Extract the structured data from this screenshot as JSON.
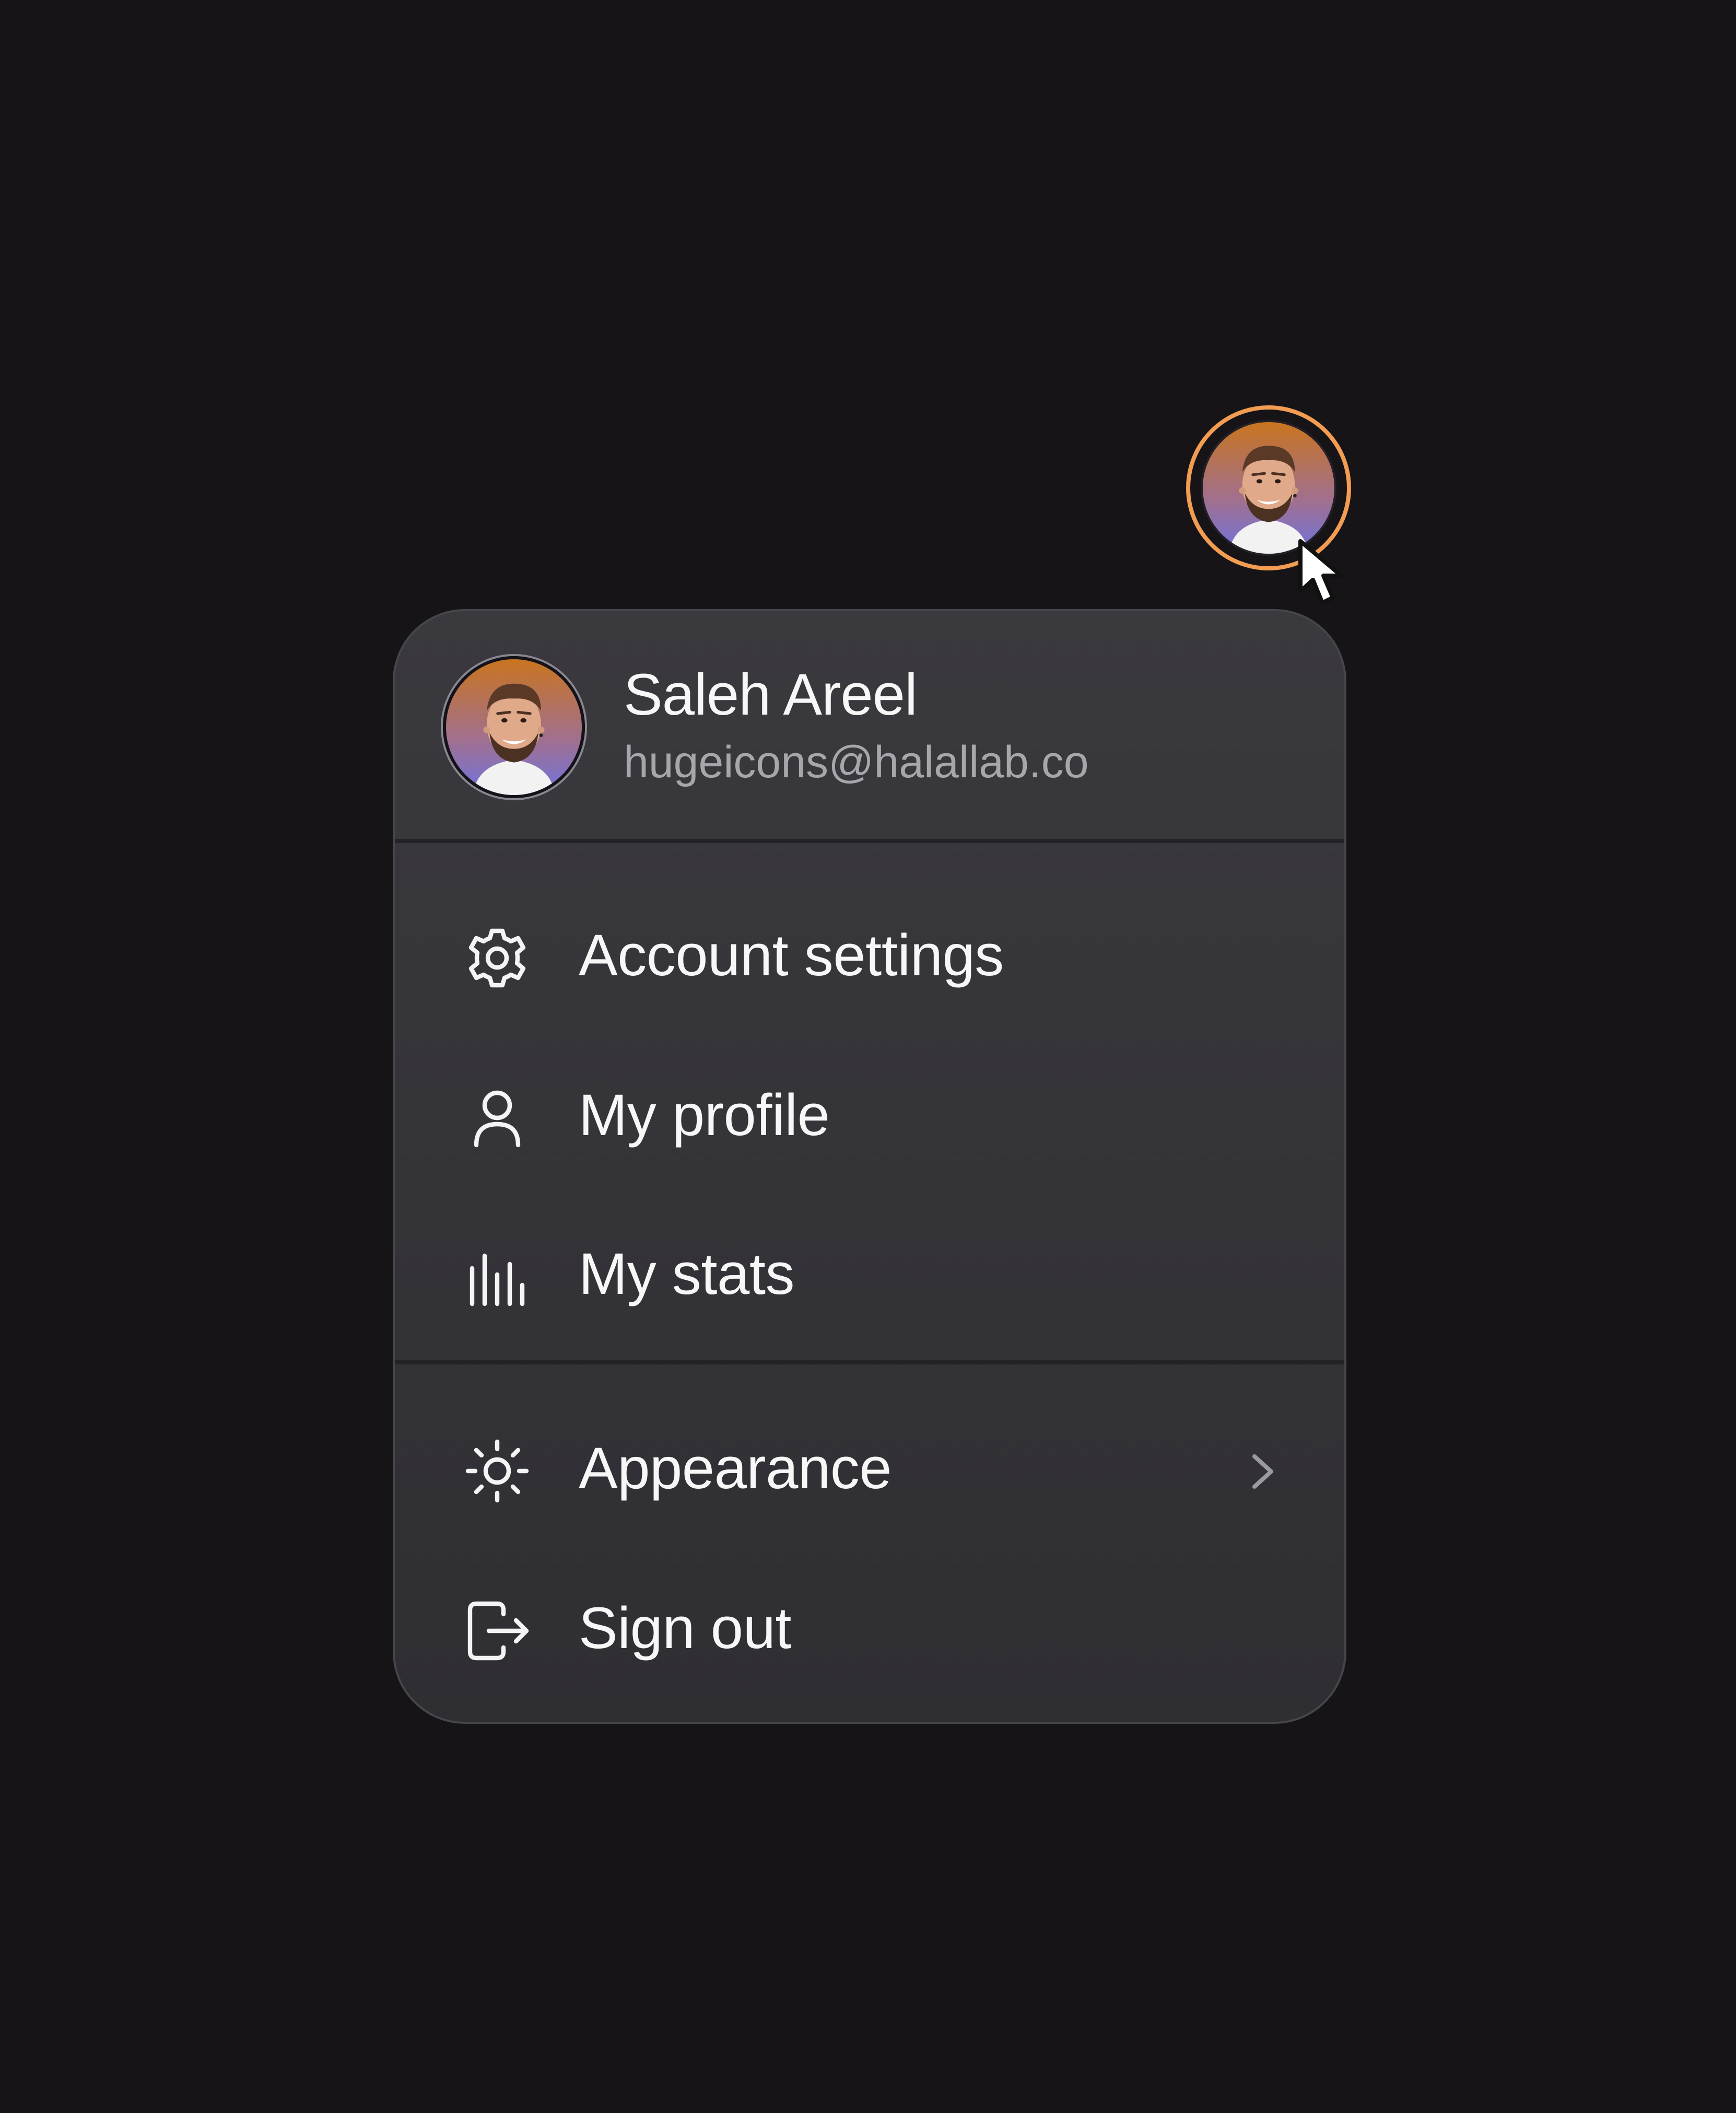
{
  "user": {
    "name": "Saleh Areel",
    "email": "hugeicons@halallab.co"
  },
  "menu": {
    "items": [
      {
        "label": "Account settings",
        "icon": "gear-icon"
      },
      {
        "label": "My profile",
        "icon": "user-icon"
      },
      {
        "label": "My stats",
        "icon": "stats-bars-icon"
      },
      {
        "label": "Appearance",
        "icon": "sun-icon",
        "submenu_indicator": "chevron-right-icon"
      },
      {
        "label": "Sign out",
        "icon": "logout-icon"
      }
    ]
  },
  "colors": {
    "background": "#161417",
    "menu_surface": "#38373c",
    "accent_ring": "#f29d52",
    "text_primary": "#f7f7f8",
    "text_secondary": "#a7a6ab"
  }
}
